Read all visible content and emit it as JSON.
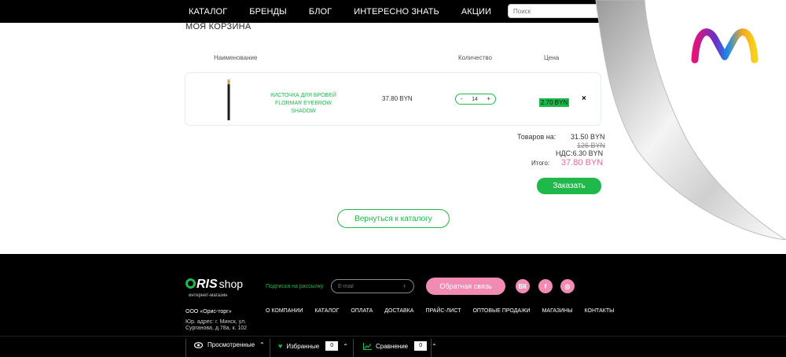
{
  "nav": {
    "items": [
      "КАТАЛОГ",
      "БРЕНДЫ",
      "БЛОГ",
      "ИНТЕРЕСНО ЗНАТЬ",
      "АКЦИИ"
    ],
    "search_placeholder": "Поиск"
  },
  "cart": {
    "title": "МОЯ КОРЗИНА",
    "headers": {
      "name": "Наименование",
      "quantity": "Количество",
      "price": "Цена"
    },
    "item": {
      "name_line1": "КИСТОЧКА ДЛЯ БРОВЕЙ",
      "name_line2": "FLORMAR EYEBROW SHADOW",
      "price": "37.80 BYN",
      "qty_minus": "-",
      "quantity": "14",
      "qty_plus": "+",
      "row_total": "2.70 BYN",
      "remove": "×"
    },
    "summary": {
      "goods_label": "Товаров на:",
      "goods_value": "31.50 BYN",
      "old_value": "126 BYN",
      "vat": "НДС:6.30 BYN",
      "total_label": "Итого:",
      "total_value": "37.80 BYN"
    },
    "order_button": "Заказать",
    "back_button": "Вернуться к каталогу"
  },
  "footer": {
    "logo_text": "RIS",
    "logo_shop": "shop",
    "logo_sub": "интернет-магазин",
    "company": "ООО «Орис-торг»",
    "address": "Юр. адрес: г. Минск, ул. Сурганова, д.78а, к. 102",
    "newsletter_label": "Подписка на рассылку",
    "email_placeholder": "E-mail",
    "feedback_button": "Обратная связь",
    "social": [
      "ВК",
      "f",
      "◎"
    ],
    "menu": [
      "О КОМПАНИИ",
      "КАТАЛОГ",
      "ОПЛАТА",
      "ДОСТАВКА",
      "ПРАЙС-ЛИСТ",
      "ОПТОВЫЕ ПРОДАЖИ",
      "МАГАЗИНЫ",
      "КОНТАКТЫ"
    ]
  },
  "bottombar": {
    "viewed": "Просмотренные",
    "favorites": "Избранные",
    "favorites_count": "0",
    "compare": "Сравнение",
    "compare_count": "0"
  },
  "colors": {
    "accent": "#1fb84a",
    "pink": "#f28bb4",
    "total_pink": "#e86a98"
  }
}
